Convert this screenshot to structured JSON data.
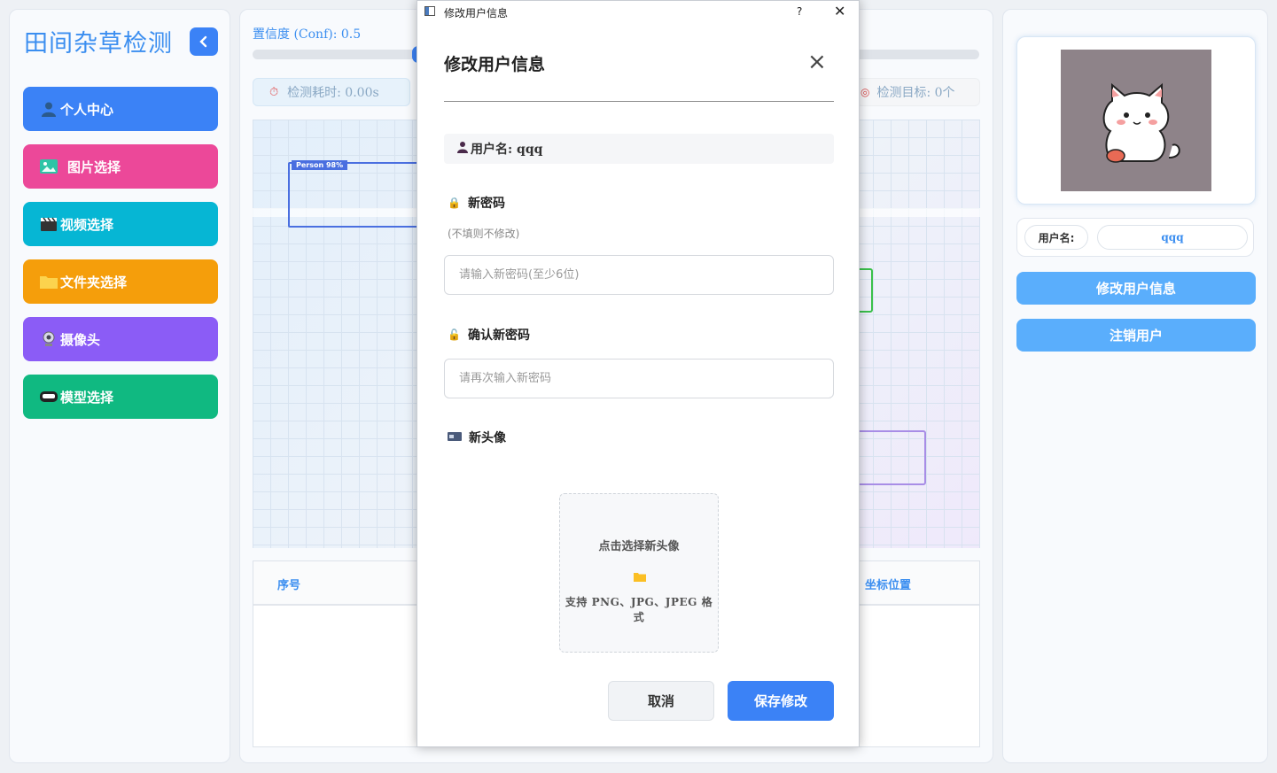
{
  "sidebar": {
    "title": "田间杂草检测",
    "items": [
      {
        "label": "个人中心",
        "icon": "person-icon",
        "color": "#3b82f6"
      },
      {
        "label": "图片选择",
        "icon": "image-icon",
        "color": "#ec4899"
      },
      {
        "label": "视频选择",
        "icon": "clapper-icon",
        "color": "#06b6d4"
      },
      {
        "label": "文件夹选择",
        "icon": "folder-icon",
        "color": "#f59e0b"
      },
      {
        "label": "摄像头",
        "icon": "webcam-icon",
        "color": "#8b5cf6"
      },
      {
        "label": "模型选择",
        "icon": "vr-headset-icon",
        "color": "#10b981"
      }
    ]
  },
  "main": {
    "conf_label": "置信度 (Conf): 0.5",
    "time_stat": "检测耗时: 0.00s",
    "target_stat": "检测目标: 0个",
    "detection_label": "Person 98%",
    "table_headers": {
      "index": "序号",
      "position": "坐标位置"
    }
  },
  "profile": {
    "username_label": "用户名:",
    "username_value": "qqq",
    "edit_button": "修改用户信息",
    "logout_button": "注销用户"
  },
  "dialog": {
    "window_title": "修改用户信息",
    "help": "?",
    "heading": "修改用户信息",
    "username_line": "用户名: qqq",
    "new_password_label": "新密码",
    "new_password_hint": "(不填则不修改)",
    "new_password_placeholder": "请输入新密码(至少6位)",
    "confirm_label": "确认新密码",
    "confirm_placeholder": "请再次输入新密码",
    "avatar_label": "新头像",
    "upload_title": "点击选择新头像",
    "upload_formats": "支持 PNG、JPG、JPEG 格式",
    "cancel_button": "取消",
    "save_button": "保存修改"
  },
  "colors": {
    "accent": "#3b82f6",
    "light_accent": "#5aaefc"
  }
}
